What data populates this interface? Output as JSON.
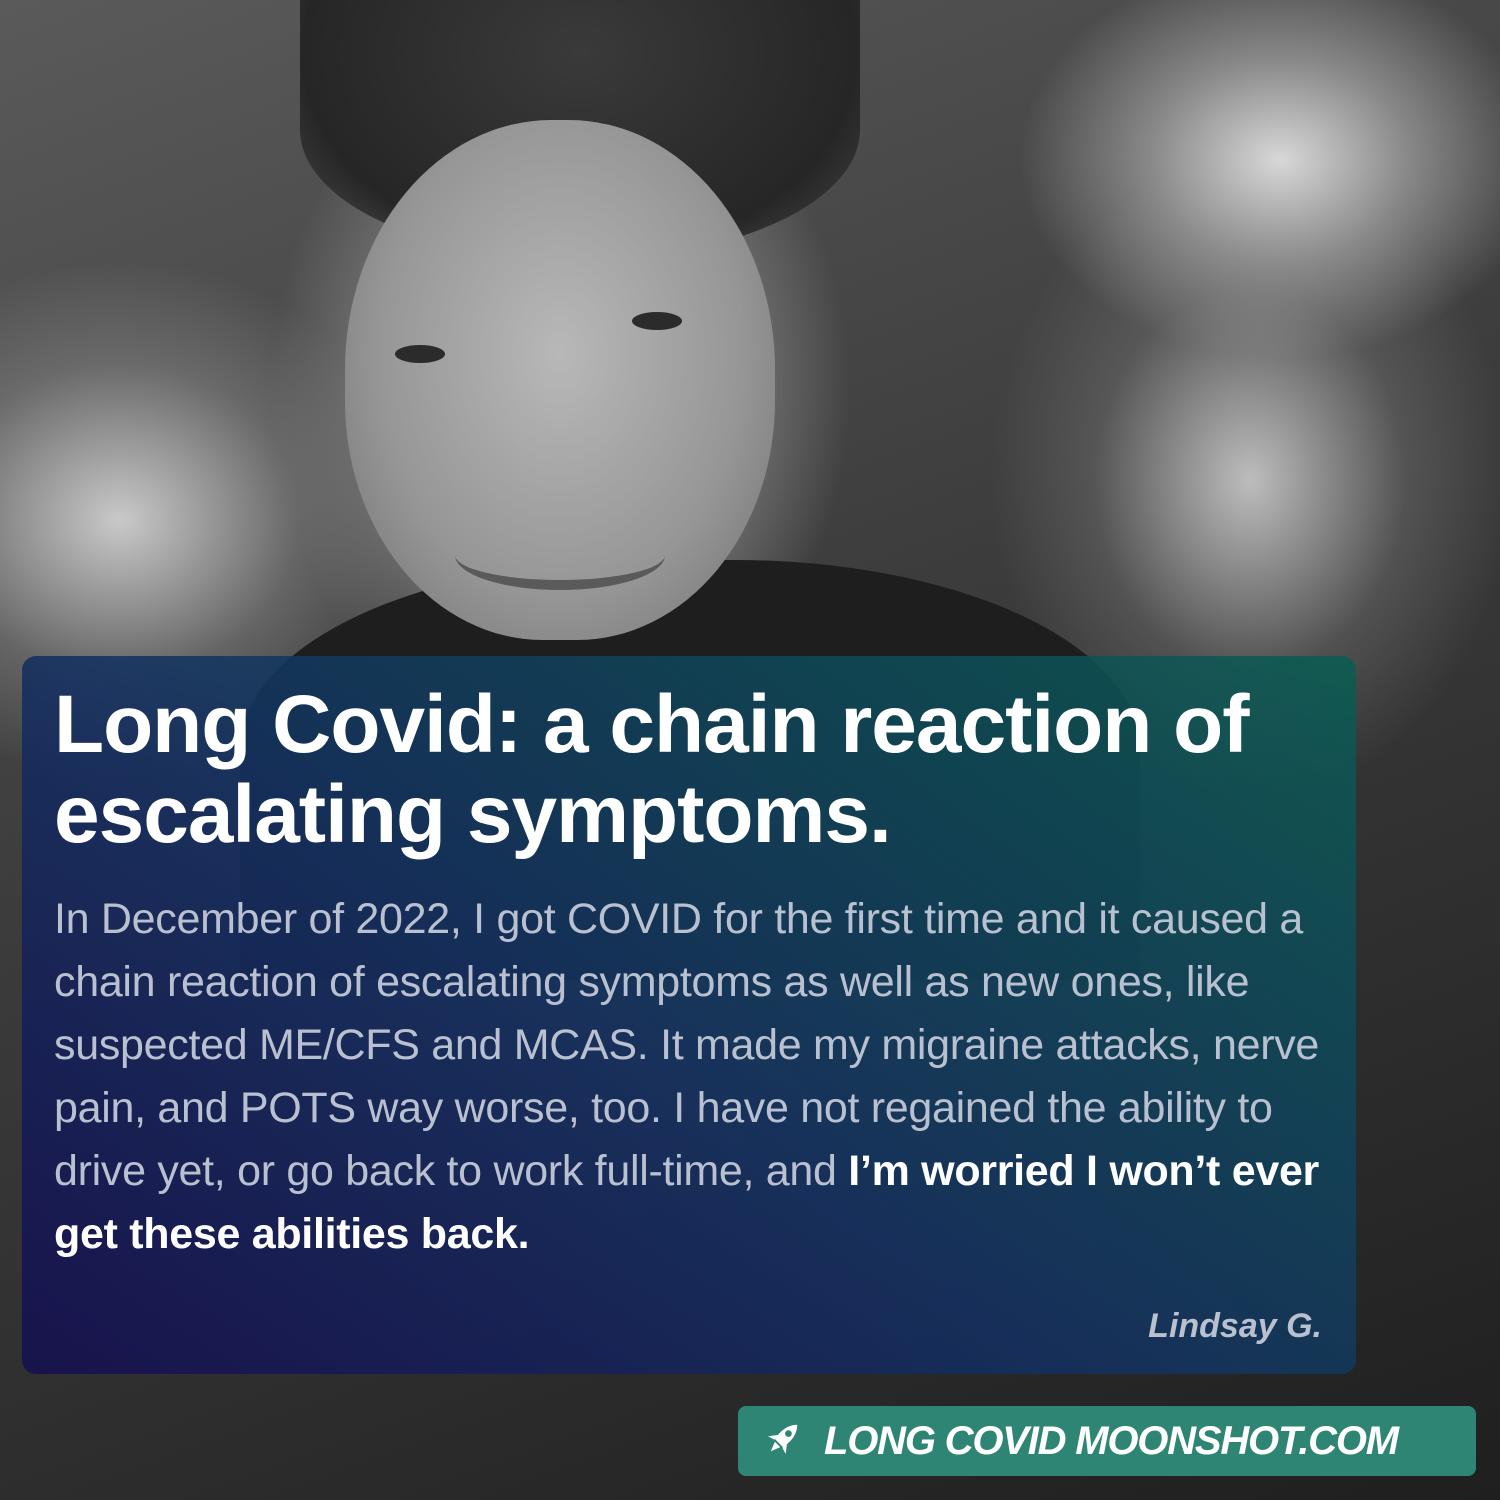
{
  "post": {
    "headline": "Long Covid: a chain reaction of escalating symptoms.",
    "body_text": "In December of 2022, I got COVID for the first time and it caused a chain reaction of escalating symptoms as well as new ones, like suspected ME/CFS and MCAS. It made my migraine attacks, nerve pain, and POTS way worse, too. I have not regained the ability to drive yet, or go back to work full-time, and ",
    "body_emphasis": "I’m worried I won’t ever get these abilities back.",
    "attribution": "Lindsay G."
  },
  "branding": {
    "site": "LONG COVID MOONSHOT.COM",
    "icon": "rocket-icon",
    "badge_color": "#2f8574"
  },
  "colors": {
    "card_gradient_start": "#16104e",
    "card_gradient_end": "#0a5c52",
    "headline": "#ffffff",
    "body": "#b9c0cf"
  }
}
